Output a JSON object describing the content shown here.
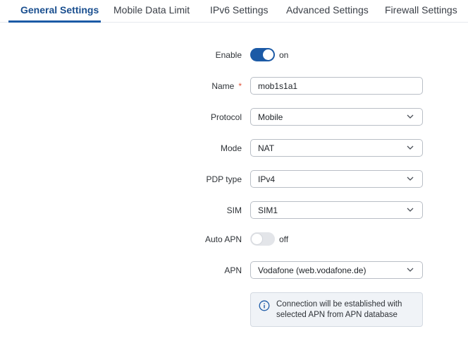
{
  "tabs": [
    {
      "label": "General Settings",
      "active": true
    },
    {
      "label": "Mobile Data Limit",
      "active": false
    },
    {
      "label": "IPv6 Settings",
      "active": false
    },
    {
      "label": "Advanced Settings",
      "active": false
    },
    {
      "label": "Firewall Settings",
      "active": false
    }
  ],
  "form": {
    "enable": {
      "label": "Enable",
      "state": "on"
    },
    "name": {
      "label": "Name",
      "required_mark": "*",
      "value": "mob1s1a1"
    },
    "protocol": {
      "label": "Protocol",
      "value": "Mobile"
    },
    "mode": {
      "label": "Mode",
      "value": "NAT"
    },
    "pdp_type": {
      "label": "PDP type",
      "value": "IPv4"
    },
    "sim": {
      "label": "SIM",
      "value": "SIM1"
    },
    "auto_apn": {
      "label": "Auto APN",
      "state": "off"
    },
    "apn": {
      "label": "APN",
      "value": "Vodafone (web.vodafone.de)"
    }
  },
  "info": {
    "icon": "info-circle-icon",
    "text": "Connection will be established with selected APN from APN database"
  },
  "colors": {
    "accent": "#1c5aa6",
    "required": "#e0533a",
    "info_bg": "#f0f3f7"
  }
}
